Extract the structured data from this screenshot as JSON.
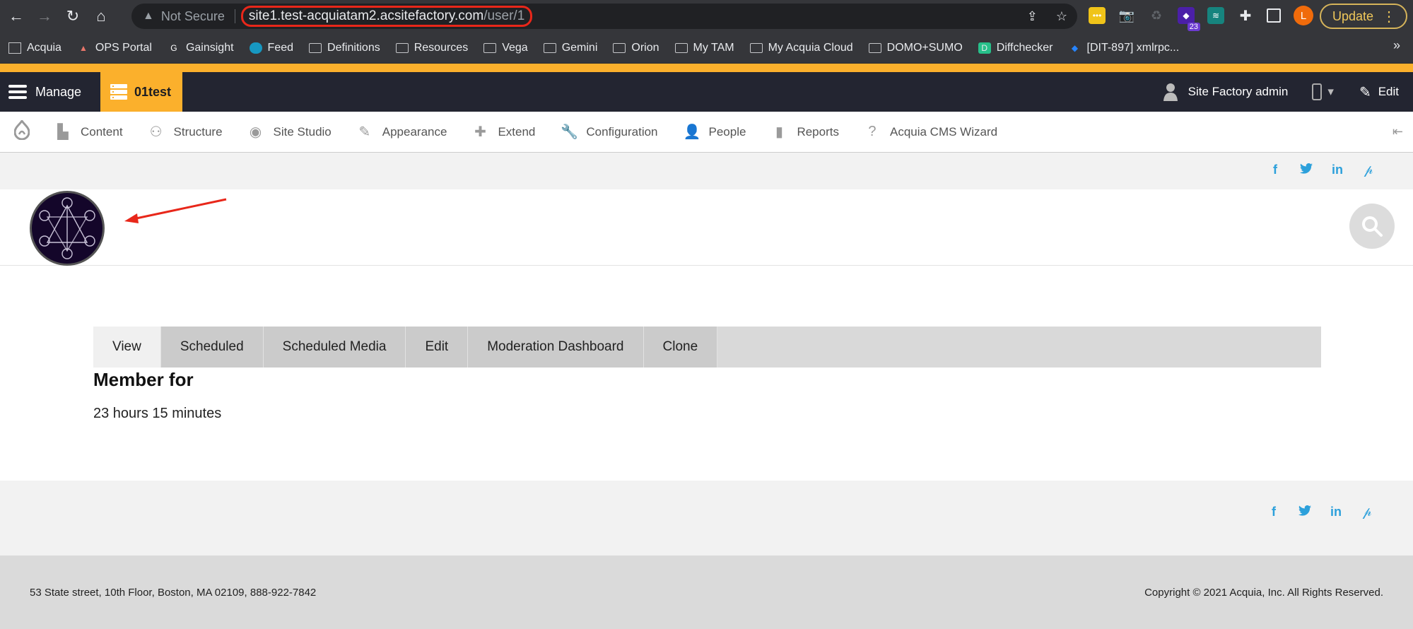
{
  "browser": {
    "nav": {
      "back": "←",
      "forward": "→",
      "reload": "↻",
      "home": "⌂"
    },
    "security_label": "Not Secure",
    "url_host": "site1.test-acquiatam2.acsitefactory.com",
    "url_path": "/user/1",
    "extension_badge": "23",
    "profile_initial": "L",
    "update_label": "Update",
    "bookmarks": [
      {
        "label": "Acquia",
        "icon": "building-icon"
      },
      {
        "label": "OPS Portal",
        "icon": "ops-icon"
      },
      {
        "label": "Gainsight",
        "icon": "gainsight-icon"
      },
      {
        "label": "Feed",
        "icon": "salesforce-cloud-icon"
      },
      {
        "label": "Definitions",
        "icon": "folder-icon"
      },
      {
        "label": "Resources",
        "icon": "folder-icon"
      },
      {
        "label": "Vega",
        "icon": "folder-icon"
      },
      {
        "label": "Gemini",
        "icon": "folder-icon"
      },
      {
        "label": "Orion",
        "icon": "folder-icon"
      },
      {
        "label": "My TAM",
        "icon": "folder-icon"
      },
      {
        "label": "My Acquia Cloud",
        "icon": "folder-icon"
      },
      {
        "label": "DOMO+SUMO",
        "icon": "folder-icon"
      },
      {
        "label": "Diffchecker",
        "icon": "diffchecker-icon"
      },
      {
        "label": "[DIT-897] xmlrpc...",
        "icon": "jira-icon"
      }
    ],
    "bookmarks_overflow": "»"
  },
  "toolbar": {
    "manage_label": "Manage",
    "site_label": "01test",
    "user_label": "Site Factory admin",
    "edit_label": "Edit"
  },
  "admin_menu": [
    {
      "label": "Content",
      "icon": "file-icon",
      "glyph": "▙"
    },
    {
      "label": "Structure",
      "icon": "sitemap-icon",
      "glyph": "⚇"
    },
    {
      "label": "Site Studio",
      "icon": "site-studio-icon",
      "glyph": "◉"
    },
    {
      "label": "Appearance",
      "icon": "paintbrush-icon",
      "glyph": "✎"
    },
    {
      "label": "Extend",
      "icon": "puzzle-icon",
      "glyph": "✚"
    },
    {
      "label": "Configuration",
      "icon": "wrench-icon",
      "glyph": "🔧"
    },
    {
      "label": "People",
      "icon": "people-icon",
      "glyph": "👤"
    },
    {
      "label": "Reports",
      "icon": "bar-chart-icon",
      "glyph": "▮"
    },
    {
      "label": "Acquia CMS Wizard",
      "icon": "question-icon",
      "glyph": "?"
    }
  ],
  "social": {
    "facebook": "f",
    "twitter": "🐦",
    "linkedin": "in",
    "pinterest": "℗"
  },
  "tabs": [
    {
      "label": "View",
      "active": true
    },
    {
      "label": "Scheduled",
      "active": false
    },
    {
      "label": "Scheduled Media",
      "active": false
    },
    {
      "label": "Edit",
      "active": false
    },
    {
      "label": "Moderation Dashboard",
      "active": false
    },
    {
      "label": "Clone",
      "active": false
    }
  ],
  "profile": {
    "member_for_label": "Member for",
    "member_for_value": "23 hours 15 minutes"
  },
  "footer": {
    "address": "53 State street, 10th Floor, Boston, MA 02109, 888-922-7842",
    "copyright": "Copyright © 2021 Acquia, Inc. All Rights Reserved."
  },
  "colors": {
    "accent": "#fbb02c",
    "toolbar_bg": "#232531",
    "social_blue": "#2ca0db",
    "annotation_red": "#e8271a"
  }
}
